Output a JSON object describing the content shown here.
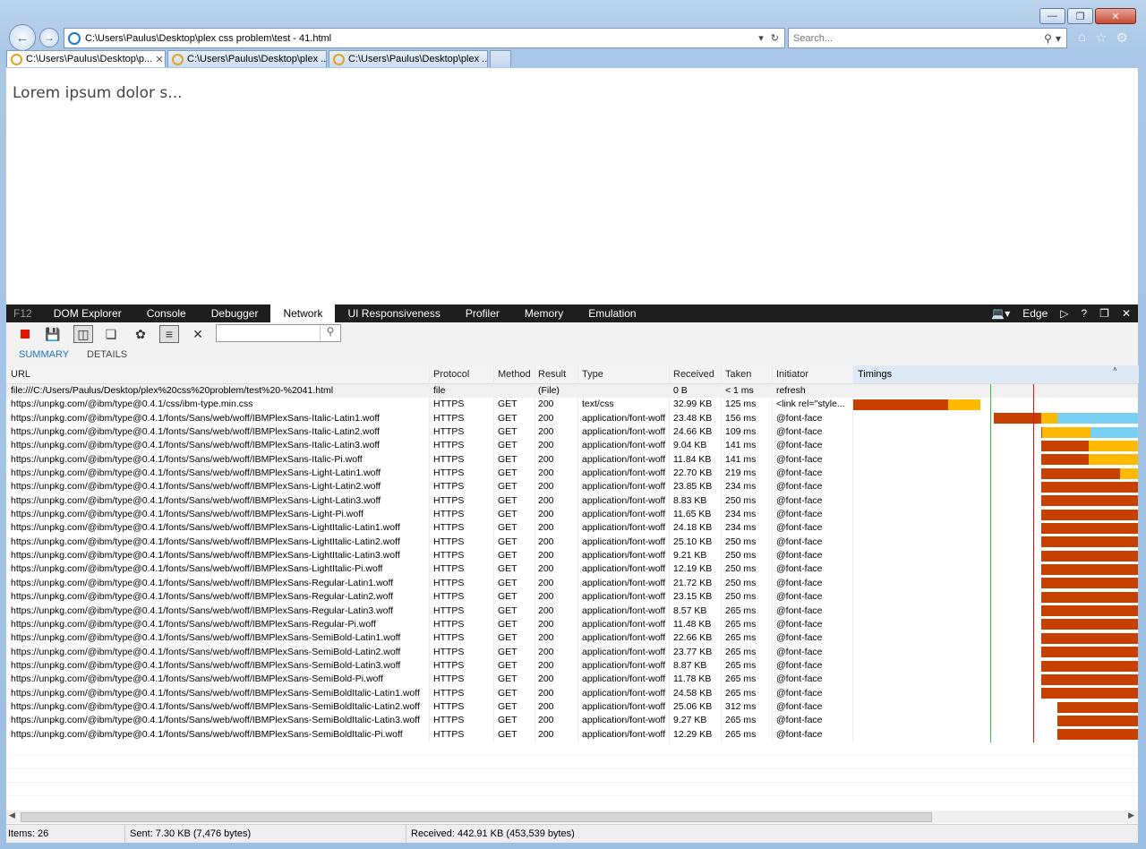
{
  "browser": {
    "address": "C:\\Users\\Paulus\\Desktop\\plex css problem\\test - 41.html",
    "search_placeholder": "Search...",
    "tabs": [
      {
        "label": "C:\\Users\\Paulus\\Desktop\\p..."
      },
      {
        "label": "C:\\Users\\Paulus\\Desktop\\plex ..."
      },
      {
        "label": "C:\\Users\\Paulus\\Desktop\\plex ..."
      }
    ]
  },
  "page": {
    "text": "Lorem ipsum dolor s..."
  },
  "devtools": {
    "f12": "F12",
    "tabs": [
      "DOM Explorer",
      "Console",
      "Debugger",
      "Network",
      "UI Responsiveness",
      "Profiler",
      "Memory",
      "Emulation"
    ],
    "active_tab": "Network",
    "mode": "Edge",
    "subtabs": [
      "SUMMARY",
      "DETAILS"
    ],
    "columns": [
      "URL",
      "Protocol",
      "Method",
      "Result",
      "Type",
      "Received",
      "Taken",
      "Initiator",
      "Timings"
    ],
    "rows": [
      [
        "file:///C:/Users/Paulus/Desktop/plex%20css%20problem/test%20-%2041.html",
        "file",
        "",
        "(File)",
        "",
        "0 B",
        "< 1 ms",
        "refresh"
      ],
      [
        "https://unpkg.com/@ibm/type@0.4.1/css/ibm-type.min.css",
        "HTTPS",
        "GET",
        "200",
        "text/css",
        "32.99 KB",
        "125 ms",
        "<link rel=\"style..."
      ],
      [
        "https://unpkg.com/@ibm/type@0.4.1/fonts/Sans/web/woff/IBMPlexSans-Italic-Latin1.woff",
        "HTTPS",
        "GET",
        "200",
        "application/font-woff",
        "23.48 KB",
        "156 ms",
        "@font-face"
      ],
      [
        "https://unpkg.com/@ibm/type@0.4.1/fonts/Sans/web/woff/IBMPlexSans-Italic-Latin2.woff",
        "HTTPS",
        "GET",
        "200",
        "application/font-woff",
        "24.66 KB",
        "109 ms",
        "@font-face"
      ],
      [
        "https://unpkg.com/@ibm/type@0.4.1/fonts/Sans/web/woff/IBMPlexSans-Italic-Latin3.woff",
        "HTTPS",
        "GET",
        "200",
        "application/font-woff",
        "9.04 KB",
        "141 ms",
        "@font-face"
      ],
      [
        "https://unpkg.com/@ibm/type@0.4.1/fonts/Sans/web/woff/IBMPlexSans-Italic-Pi.woff",
        "HTTPS",
        "GET",
        "200",
        "application/font-woff",
        "11.84 KB",
        "141 ms",
        "@font-face"
      ],
      [
        "https://unpkg.com/@ibm/type@0.4.1/fonts/Sans/web/woff/IBMPlexSans-Light-Latin1.woff",
        "HTTPS",
        "GET",
        "200",
        "application/font-woff",
        "22.70 KB",
        "219 ms",
        "@font-face"
      ],
      [
        "https://unpkg.com/@ibm/type@0.4.1/fonts/Sans/web/woff/IBMPlexSans-Light-Latin2.woff",
        "HTTPS",
        "GET",
        "200",
        "application/font-woff",
        "23.85 KB",
        "234 ms",
        "@font-face"
      ],
      [
        "https://unpkg.com/@ibm/type@0.4.1/fonts/Sans/web/woff/IBMPlexSans-Light-Latin3.woff",
        "HTTPS",
        "GET",
        "200",
        "application/font-woff",
        "8.83 KB",
        "250 ms",
        "@font-face"
      ],
      [
        "https://unpkg.com/@ibm/type@0.4.1/fonts/Sans/web/woff/IBMPlexSans-Light-Pi.woff",
        "HTTPS",
        "GET",
        "200",
        "application/font-woff",
        "11.65 KB",
        "234 ms",
        "@font-face"
      ],
      [
        "https://unpkg.com/@ibm/type@0.4.1/fonts/Sans/web/woff/IBMPlexSans-LightItalic-Latin1.woff",
        "HTTPS",
        "GET",
        "200",
        "application/font-woff",
        "24.18 KB",
        "234 ms",
        "@font-face"
      ],
      [
        "https://unpkg.com/@ibm/type@0.4.1/fonts/Sans/web/woff/IBMPlexSans-LightItalic-Latin2.woff",
        "HTTPS",
        "GET",
        "200",
        "application/font-woff",
        "25.10 KB",
        "250 ms",
        "@font-face"
      ],
      [
        "https://unpkg.com/@ibm/type@0.4.1/fonts/Sans/web/woff/IBMPlexSans-LightItalic-Latin3.woff",
        "HTTPS",
        "GET",
        "200",
        "application/font-woff",
        "9.21 KB",
        "250 ms",
        "@font-face"
      ],
      [
        "https://unpkg.com/@ibm/type@0.4.1/fonts/Sans/web/woff/IBMPlexSans-LightItalic-Pi.woff",
        "HTTPS",
        "GET",
        "200",
        "application/font-woff",
        "12.19 KB",
        "250 ms",
        "@font-face"
      ],
      [
        "https://unpkg.com/@ibm/type@0.4.1/fonts/Sans/web/woff/IBMPlexSans-Regular-Latin1.woff",
        "HTTPS",
        "GET",
        "200",
        "application/font-woff",
        "21.72 KB",
        "250 ms",
        "@font-face"
      ],
      [
        "https://unpkg.com/@ibm/type@0.4.1/fonts/Sans/web/woff/IBMPlexSans-Regular-Latin2.woff",
        "HTTPS",
        "GET",
        "200",
        "application/font-woff",
        "23.15 KB",
        "250 ms",
        "@font-face"
      ],
      [
        "https://unpkg.com/@ibm/type@0.4.1/fonts/Sans/web/woff/IBMPlexSans-Regular-Latin3.woff",
        "HTTPS",
        "GET",
        "200",
        "application/font-woff",
        "8.57 KB",
        "265 ms",
        "@font-face"
      ],
      [
        "https://unpkg.com/@ibm/type@0.4.1/fonts/Sans/web/woff/IBMPlexSans-Regular-Pi.woff",
        "HTTPS",
        "GET",
        "200",
        "application/font-woff",
        "11.48 KB",
        "265 ms",
        "@font-face"
      ],
      [
        "https://unpkg.com/@ibm/type@0.4.1/fonts/Sans/web/woff/IBMPlexSans-SemiBold-Latin1.woff",
        "HTTPS",
        "GET",
        "200",
        "application/font-woff",
        "22.66 KB",
        "265 ms",
        "@font-face"
      ],
      [
        "https://unpkg.com/@ibm/type@0.4.1/fonts/Sans/web/woff/IBMPlexSans-SemiBold-Latin2.woff",
        "HTTPS",
        "GET",
        "200",
        "application/font-woff",
        "23.77 KB",
        "265 ms",
        "@font-face"
      ],
      [
        "https://unpkg.com/@ibm/type@0.4.1/fonts/Sans/web/woff/IBMPlexSans-SemiBold-Latin3.woff",
        "HTTPS",
        "GET",
        "200",
        "application/font-woff",
        "8.87 KB",
        "265 ms",
        "@font-face"
      ],
      [
        "https://unpkg.com/@ibm/type@0.4.1/fonts/Sans/web/woff/IBMPlexSans-SemiBold-Pi.woff",
        "HTTPS",
        "GET",
        "200",
        "application/font-woff",
        "11.78 KB",
        "265 ms",
        "@font-face"
      ],
      [
        "https://unpkg.com/@ibm/type@0.4.1/fonts/Sans/web/woff/IBMPlexSans-SemiBoldItalic-Latin1.woff",
        "HTTPS",
        "GET",
        "200",
        "application/font-woff",
        "24.58 KB",
        "265 ms",
        "@font-face"
      ],
      [
        "https://unpkg.com/@ibm/type@0.4.1/fonts/Sans/web/woff/IBMPlexSans-SemiBoldItalic-Latin2.woff",
        "HTTPS",
        "GET",
        "200",
        "application/font-woff",
        "25.06 KB",
        "312 ms",
        "@font-face"
      ],
      [
        "https://unpkg.com/@ibm/type@0.4.1/fonts/Sans/web/woff/IBMPlexSans-SemiBoldItalic-Latin3.woff",
        "HTTPS",
        "GET",
        "200",
        "application/font-woff",
        "9.27 KB",
        "265 ms",
        "@font-face"
      ],
      [
        "https://unpkg.com/@ibm/type@0.4.1/fonts/Sans/web/woff/IBMPlexSans-SemiBoldItalic-Pi.woff",
        "HTTPS",
        "GET",
        "200",
        "application/font-woff",
        "12.29 KB",
        "265 ms",
        "@font-face"
      ]
    ],
    "status": {
      "items": "Items: 26",
      "sent": "Sent: 7.30 KB (7,476 bytes)",
      "received": "Received: 442.91 KB (453,539 bytes)"
    },
    "colors": {
      "wait": "#c84000",
      "receive": "#ffb900",
      "cached": "#78d1f5",
      "dom_loaded": "#3cbf3c",
      "load": "#e01010"
    }
  }
}
